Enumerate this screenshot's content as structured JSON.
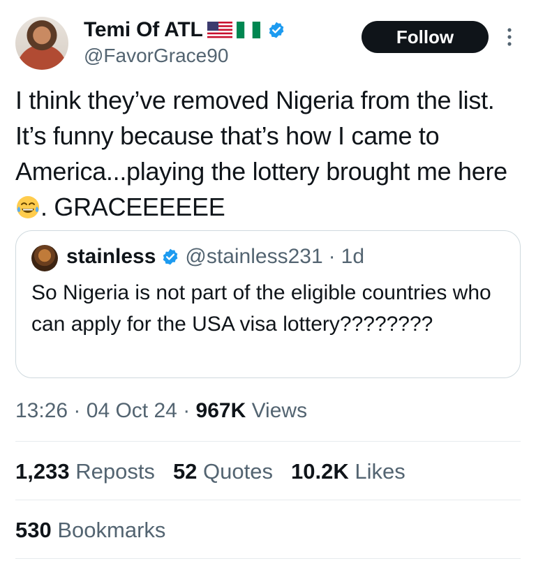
{
  "author": {
    "name": "Temi Of ATL",
    "handle": "@FavorGrace90",
    "follow_label": "Follow"
  },
  "tweet": {
    "text_before_emoji": "I think they’ve removed Nigeria from the list. It’s funny because that’s how I came to America...playing the lottery brought me here",
    "text_after_emoji": ". GRACEEEEEE",
    "emoji": "face-with-tears-of-joy"
  },
  "quoted": {
    "name": "stainless",
    "handle": "@stainless231",
    "separator": "·",
    "age": "1d",
    "text": "So Nigeria is not part of the eligible countries who can apply for the USA visa lottery????????"
  },
  "meta": {
    "time": "13:26",
    "date": "04 Oct 24",
    "views_count": "967K",
    "views_label": "Views",
    "separator": "·"
  },
  "stats": {
    "reposts_count": "1,233",
    "reposts_label": "Reposts",
    "quotes_count": "52",
    "quotes_label": "Quotes",
    "likes_count": "10.2K",
    "likes_label": "Likes",
    "bookmarks_count": "530",
    "bookmarks_label": "Bookmarks"
  },
  "colors": {
    "verified": "#1d9bf0",
    "text": "#0f1419",
    "muted": "#536471",
    "border": "#cfd9de"
  }
}
